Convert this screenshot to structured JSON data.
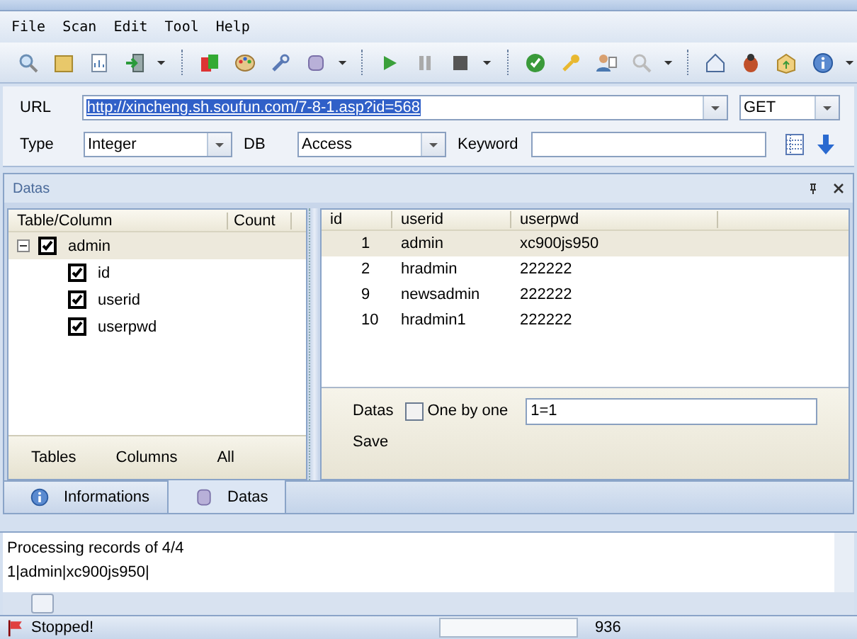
{
  "menu": [
    "File",
    "Scan",
    "Edit",
    "Tool",
    "Help"
  ],
  "form": {
    "url_label": "URL",
    "url": "http://xincheng.sh.soufun.com/7-8-1.asp?id=568",
    "method": "GET",
    "type_label": "Type",
    "type": "Integer",
    "db_label": "DB",
    "db": "Access",
    "keyword_label": "Keyword"
  },
  "panel": {
    "title": "Datas"
  },
  "tree": {
    "columns": [
      "Table/Column",
      "Count"
    ],
    "items": [
      {
        "label": "admin",
        "checked": true,
        "expanded": true,
        "selected": true,
        "children": [
          {
            "label": "id",
            "checked": true
          },
          {
            "label": "userid",
            "checked": true
          },
          {
            "label": "userpwd",
            "checked": true
          }
        ]
      }
    ],
    "buttons": [
      "Tables",
      "Columns",
      "All"
    ]
  },
  "table": {
    "columns": [
      "id",
      "userid",
      "userpwd"
    ],
    "rows": [
      {
        "cells": [
          "1",
          "admin",
          "xc900js950"
        ],
        "selected": true
      },
      {
        "cells": [
          "2",
          "hradmin",
          "222222"
        ],
        "selected": false
      },
      {
        "cells": [
          "9",
          "newsadmin",
          "222222"
        ],
        "selected": false
      },
      {
        "cells": [
          "10",
          "hradmin1",
          "222222"
        ],
        "selected": false
      }
    ]
  },
  "options": {
    "label": "Datas",
    "one_by_one": {
      "label": "One by one",
      "checked": false
    },
    "condition": "1=1",
    "save": "Save"
  },
  "tabs": [
    {
      "label": "Informations",
      "kind": "info",
      "selected": false
    },
    {
      "label": "Datas",
      "kind": "database",
      "selected": true
    }
  ],
  "log": [
    "Processing records of 4/4",
    "1|admin|xc900js950|"
  ],
  "status": {
    "text": "Stopped!",
    "count": "936"
  }
}
